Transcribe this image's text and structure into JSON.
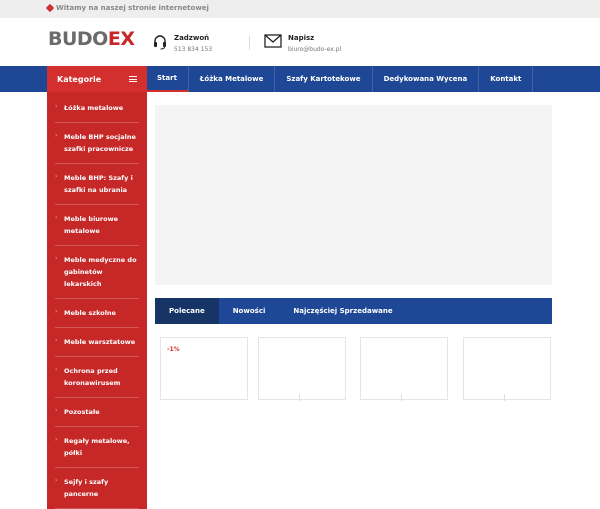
{
  "topbar": {
    "welcome": "Witamy na naszej stronie internetowej"
  },
  "header": {
    "logo_part1": "BUDO",
    "logo_part2": "EX",
    "phone_title": "Zadzwoń",
    "phone_value": "513 834 153",
    "mail_title": "Napisz",
    "mail_value": "biuro@budo-ex.pl"
  },
  "nav": {
    "items": [
      {
        "label": "Start"
      },
      {
        "label": "Łóżka Metalowe"
      },
      {
        "label": "Szafy Kartotekowe"
      },
      {
        "label": "Dedykowana Wycena"
      },
      {
        "label": "Kontakt"
      }
    ]
  },
  "sidebar": {
    "title": "Kategorie",
    "items": [
      {
        "label": "Łóżka metalowe"
      },
      {
        "label": "Meble BHP socjalne szafki pracownicze"
      },
      {
        "label": "Meble BHP: Szafy i szafki na ubrania"
      },
      {
        "label": "Meble biurowe metalowe"
      },
      {
        "label": "Meble medyczne do gabinetów lekarskich"
      },
      {
        "label": "Meble szkolne"
      },
      {
        "label": "Meble warsztatowe"
      },
      {
        "label": "Ochrona przed koronawirusem"
      },
      {
        "label": "Pozostałe"
      },
      {
        "label": "Regały metalowe, półki"
      },
      {
        "label": "Sejfy i szafy pancerne"
      }
    ]
  },
  "tabs": [
    {
      "label": "Polecane"
    },
    {
      "label": "Nowości"
    },
    {
      "label": "Najczęściej Sprzedawane"
    }
  ],
  "products": {
    "badge": "-1%"
  },
  "colors": {
    "brand_blue": "#1e4896",
    "brand_red": "#c62828"
  }
}
